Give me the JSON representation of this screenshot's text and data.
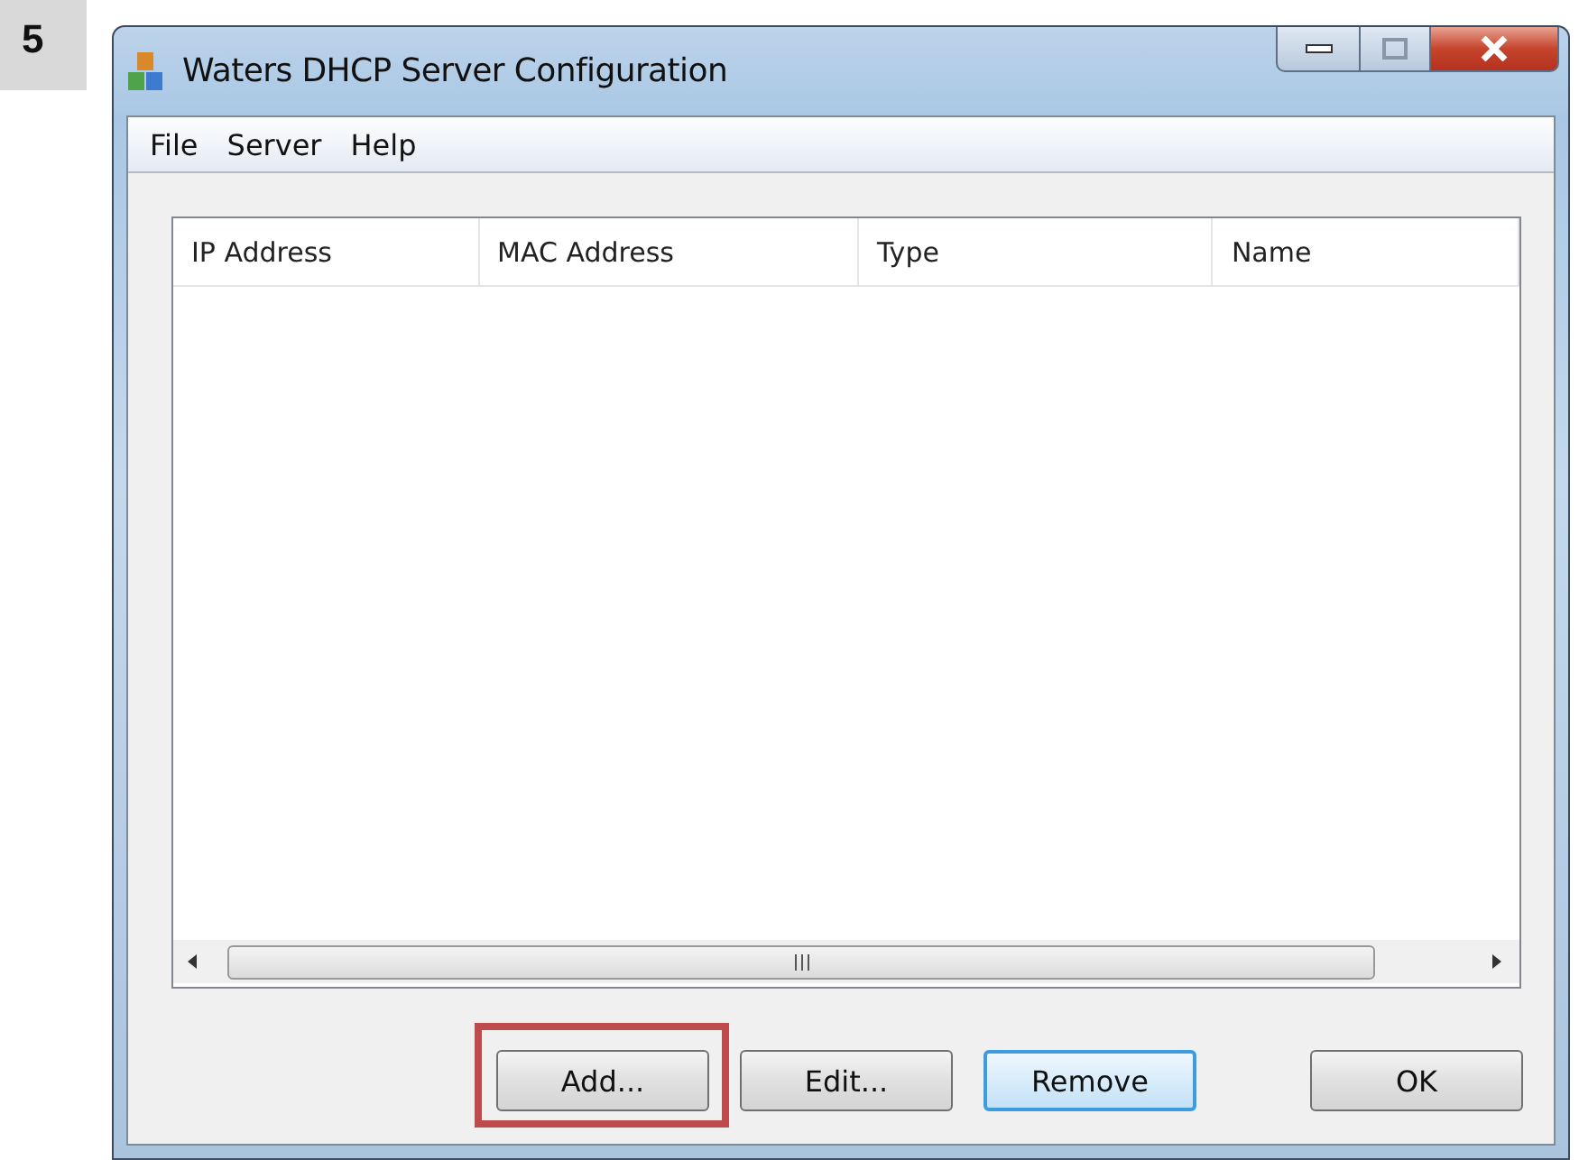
{
  "step": "5",
  "window": {
    "title": "Waters DHCP Server Configuration"
  },
  "menu": [
    "File",
    "Server",
    "Help"
  ],
  "table": {
    "columns": [
      "IP Address",
      "MAC Address",
      "Type",
      "Name"
    ]
  },
  "buttons": [
    {
      "label": "Add...",
      "focused": false,
      "highlighted": true
    },
    {
      "label": "Edit...",
      "focused": false,
      "highlighted": false
    },
    {
      "label": "Remove",
      "focused": true,
      "highlighted": false
    },
    {
      "label": "OK",
      "focused": false,
      "highlighted": false
    }
  ]
}
